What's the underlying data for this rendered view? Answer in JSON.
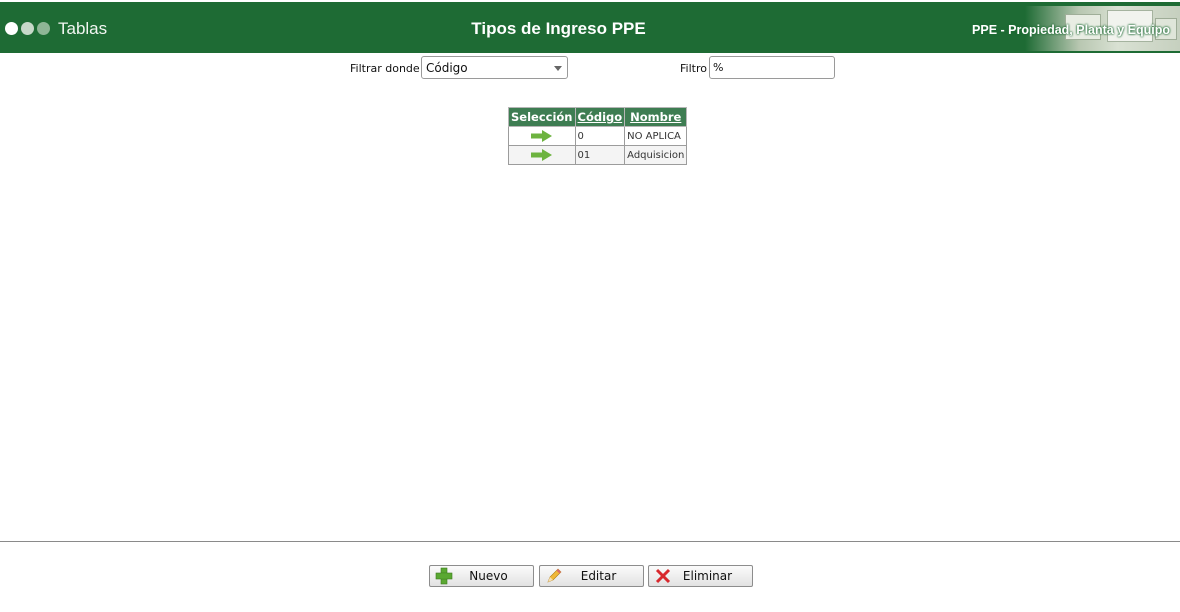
{
  "header": {
    "section_title": "Tablas",
    "page_title": "Tipos de Ingreso PPE",
    "module_label": "PPE - Propiedad, Planta y Equipo",
    "dot_colors": [
      "#ffffff",
      "#c7d9c9",
      "#8fb596"
    ]
  },
  "filters": {
    "where_label": "Filtrar donde",
    "where_value": "Código",
    "filter_label": "Filtro",
    "filter_value": "%"
  },
  "grid": {
    "columns": [
      "Selección",
      "Código",
      "Nombre"
    ],
    "rows": [
      {
        "codigo": "0",
        "nombre": "NO APLICA"
      },
      {
        "codigo": "01",
        "nombre": "Adquisicion"
      }
    ]
  },
  "footer": {
    "new_label": "Nuevo",
    "edit_label": "Editar",
    "delete_label": "Eliminar"
  },
  "colors": {
    "header_bg": "#1e6b34",
    "grid_header_bg": "#3e7d52",
    "arrow": "#6db33f"
  }
}
